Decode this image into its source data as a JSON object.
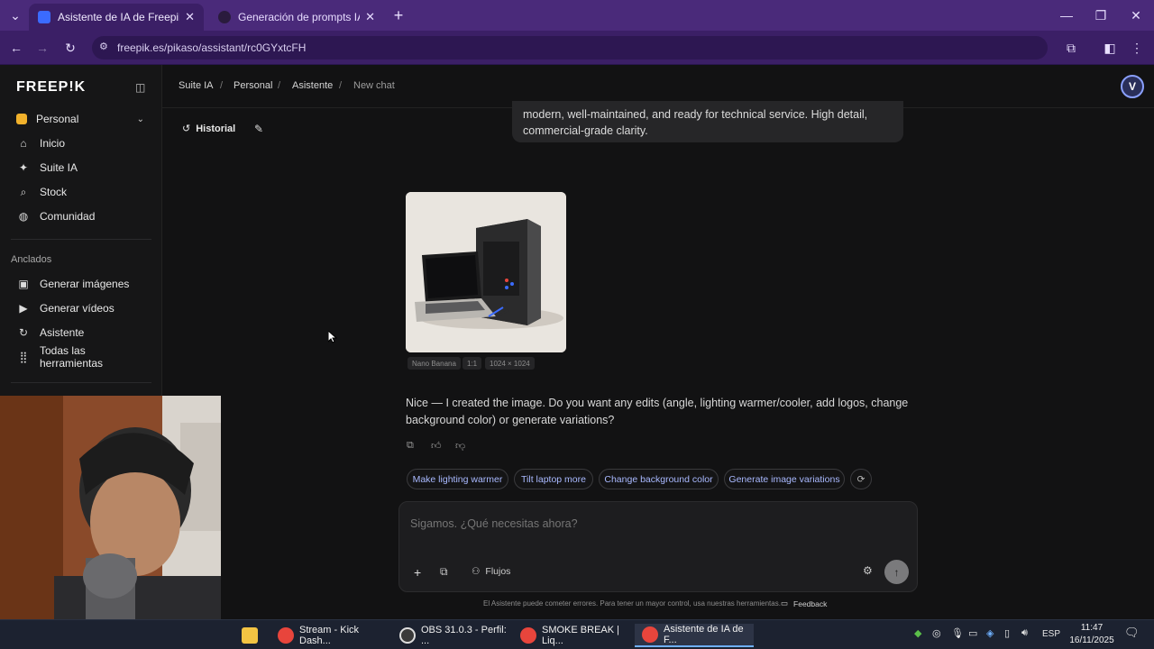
{
  "browser": {
    "tabs": [
      {
        "title": "Asistente de IA de Freepik: crea",
        "active": true
      },
      {
        "title": "Generación de prompts IA",
        "active": false
      }
    ],
    "url": "freepik.es/pikaso/assistant/rc0GYxtcFH"
  },
  "sidebar": {
    "logo": "FREEP!K",
    "workspace": "Personal",
    "nav": [
      {
        "label": "Inicio",
        "icon": "home-icon"
      },
      {
        "label": "Suite IA",
        "icon": "sparkle-icon"
      },
      {
        "label": "Stock",
        "icon": "search-icon"
      },
      {
        "label": "Comunidad",
        "icon": "globe-icon"
      }
    ],
    "pinned_label": "Anclados",
    "pinned": [
      {
        "label": "Generar imágenes",
        "icon": "image-icon"
      },
      {
        "label": "Generar vídeos",
        "icon": "video-icon"
      },
      {
        "label": "Asistente",
        "icon": "assistant-icon"
      },
      {
        "label": "Todas las herramientas",
        "icon": "grid-icon"
      }
    ]
  },
  "breadcrumb": [
    "Suite IA",
    "Personal",
    "Asistente",
    "New chat"
  ],
  "history": {
    "label": "Historial"
  },
  "chat": {
    "user_message_tail": "modern, well-maintained, and ready for technical service. High detail, commercial-grade clarity.",
    "image_tags": [
      "Nano Banana",
      "1:1",
      "1024 × 1024"
    ],
    "reply": "Nice — I created the image. Do you want any edits (angle, lighting warmer/cooler, add logos, change background color) or generate variations?",
    "suggestions": [
      "Make lighting warmer",
      "Tilt laptop more",
      "Change background color",
      "Generate image variations"
    ]
  },
  "composer": {
    "placeholder": "Sigamos. ¿Qué necesitas ahora?",
    "flujos_label": "Flujos"
  },
  "footer": {
    "disclaimer": "El Asistente puede cometer errores. Para tener un mayor control, usa nuestras herramientas.",
    "feedback": "Feedback"
  },
  "taskbar": {
    "apps": [
      {
        "label": "Stream - Kick Dash...",
        "color": "#e8453c"
      },
      {
        "label": "OBS 31.0.3 - Perfil: ...",
        "color": "#3a3a3a"
      },
      {
        "label": "SMOKE BREAK | Liq...",
        "color": "#e8453c"
      },
      {
        "label": "Asistente de IA de F...",
        "color": "#e8453c"
      }
    ],
    "lang": "ESP",
    "time": "11:47",
    "date": "16/11/2025"
  }
}
